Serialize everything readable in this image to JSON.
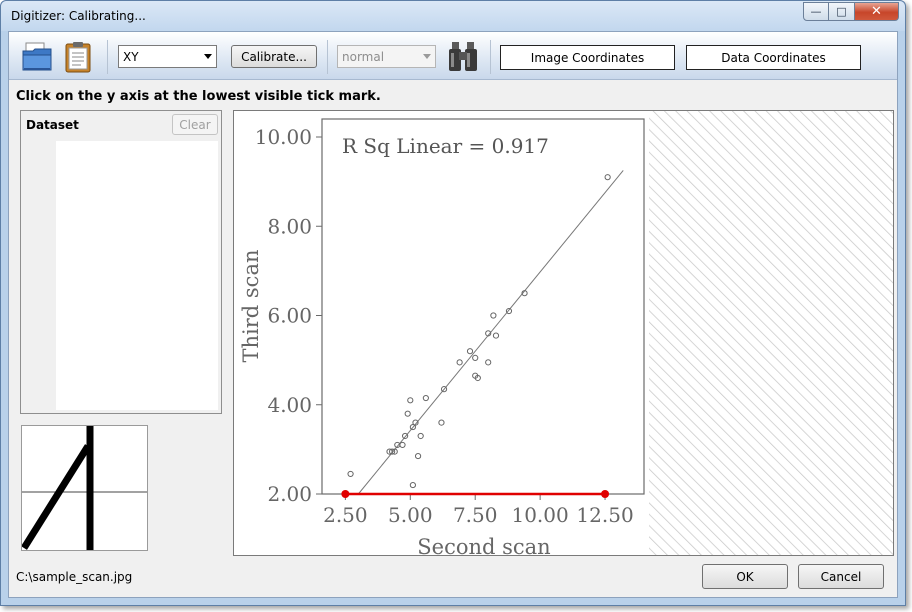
{
  "window": {
    "title": "Digitizer: Calibrating...",
    "controls": {
      "minimize": "—",
      "maximize": "□",
      "close": "✕"
    }
  },
  "toolbar": {
    "icons": [
      "open-folder-icon",
      "paste-clipboard-icon",
      "binoculars-icon"
    ],
    "mode_select": {
      "value": "XY"
    },
    "calibrate_label": "Calibrate...",
    "point_style_select": {
      "value": "normal",
      "disabled": true
    },
    "image_coordinates_label": "Image Coordinates",
    "data_coordinates_label": "Data Coordinates"
  },
  "instruction": "Click on the y axis at the lowest visible tick mark.",
  "dataset_panel": {
    "label": "Dataset",
    "clear_label": "Clear"
  },
  "scanned_image": {
    "annotation": "R Sq Linear = 0.917",
    "x_axis_label": "Second scan",
    "y_axis_label": "Third scan",
    "x_tick_labels": [
      "2.50",
      "5.00",
      "7.50",
      "10.00",
      "12.50"
    ],
    "y_tick_labels": [
      "2.00",
      "4.00",
      "6.00",
      "8.00",
      "10.00"
    ],
    "points": [
      [
        2.7,
        2.45
      ],
      [
        4.2,
        2.95
      ],
      [
        4.3,
        2.95
      ],
      [
        4.5,
        3.1
      ],
      [
        4.4,
        2.95
      ],
      [
        4.7,
        3.1
      ],
      [
        4.8,
        3.3
      ],
      [
        4.9,
        3.8
      ],
      [
        5.0,
        4.1
      ],
      [
        5.1,
        3.5
      ],
      [
        5.2,
        3.6
      ],
      [
        5.3,
        2.85
      ],
      [
        5.1,
        2.2
      ],
      [
        5.4,
        3.3
      ],
      [
        5.6,
        4.15
      ],
      [
        6.2,
        3.6
      ],
      [
        6.3,
        4.35
      ],
      [
        6.9,
        4.95
      ],
      [
        7.3,
        5.2
      ],
      [
        7.5,
        5.05
      ],
      [
        7.5,
        4.65
      ],
      [
        7.6,
        4.6
      ],
      [
        8.0,
        4.95
      ],
      [
        8.0,
        5.6
      ],
      [
        8.2,
        6.0
      ],
      [
        8.3,
        5.55
      ],
      [
        8.8,
        6.1
      ],
      [
        9.4,
        6.5
      ],
      [
        12.6,
        9.1
      ]
    ],
    "fit_line": {
      "x0": 3.0,
      "y0": 2.0,
      "x1": 13.2,
      "y1": 9.25
    },
    "calibration_line": {
      "x0": 2.5,
      "y0": 2.0,
      "x1": 12.5,
      "y1": 2.0,
      "color": "#e00000"
    }
  },
  "status": {
    "file_path": "C:\\sample_scan.jpg"
  },
  "dialog_buttons": {
    "ok_label": "OK",
    "cancel_label": "Cancel"
  }
}
